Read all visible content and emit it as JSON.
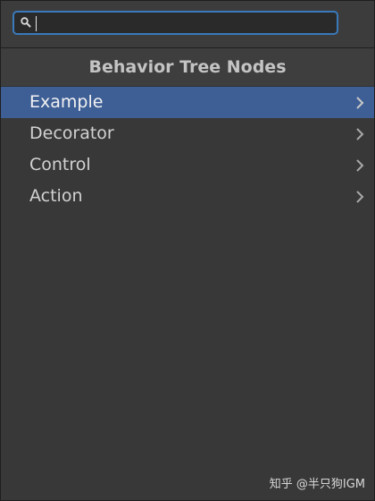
{
  "search": {
    "value": "",
    "placeholder": ""
  },
  "header": {
    "title": "Behavior Tree Nodes"
  },
  "items": [
    {
      "label": "Example",
      "selected": true
    },
    {
      "label": "Decorator",
      "selected": false
    },
    {
      "label": "Control",
      "selected": false
    },
    {
      "label": "Action",
      "selected": false
    }
  ],
  "watermark": "知乎 @半只狗IGM",
  "colors": {
    "accent": "#3e5f96",
    "search_border": "#3a79bb",
    "background": "#383838"
  },
  "icons": {
    "search": "search-icon",
    "submenu": "chevron-right-icon"
  }
}
